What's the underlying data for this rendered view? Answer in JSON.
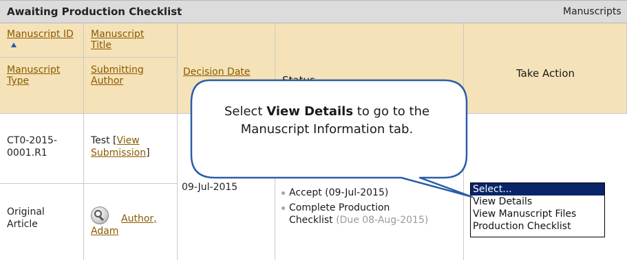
{
  "panel": {
    "title": "Awaiting Production Checklist",
    "right_label": "Manuscripts"
  },
  "columns": {
    "manuscript_id": "Manuscript ID",
    "manuscript_title": "Manuscript Title",
    "manuscript_type": "Manuscript Type",
    "submitting_author": "Submitting Author",
    "decision_date": "Decision Date",
    "status": "Status",
    "take_action": "Take Action"
  },
  "row": {
    "id": "CT0-2015-0001.R1",
    "title": "Test",
    "view_submission": "View Submission",
    "type": "Original Article",
    "author": "Author, Adam",
    "decision_date": "09-Jul-2015",
    "status_items": [
      {
        "text": "Accept (09-Jul-2015)"
      },
      {
        "text": "Complete Production Checklist",
        "due": "(Due 08-Aug-2015)"
      }
    ]
  },
  "action_select": {
    "options": [
      "Select...",
      "View Details",
      "View Manuscript Files",
      "Production Checklist"
    ],
    "selected_index": 0
  },
  "callout": {
    "prefix": "Select ",
    "bold": "View Details",
    "suffix": " to go to the Manuscript Information tab."
  },
  "icons": {
    "author_icon": "magnifier-icon",
    "sort_icon": "sort-up-arrow-icon"
  },
  "colors": {
    "header_bg": "#f5e2b8",
    "title_bg": "#dcdcdc",
    "link": "#8a5a00",
    "callout_border": "#2a5ca8",
    "selected_option": "#0a246a"
  }
}
